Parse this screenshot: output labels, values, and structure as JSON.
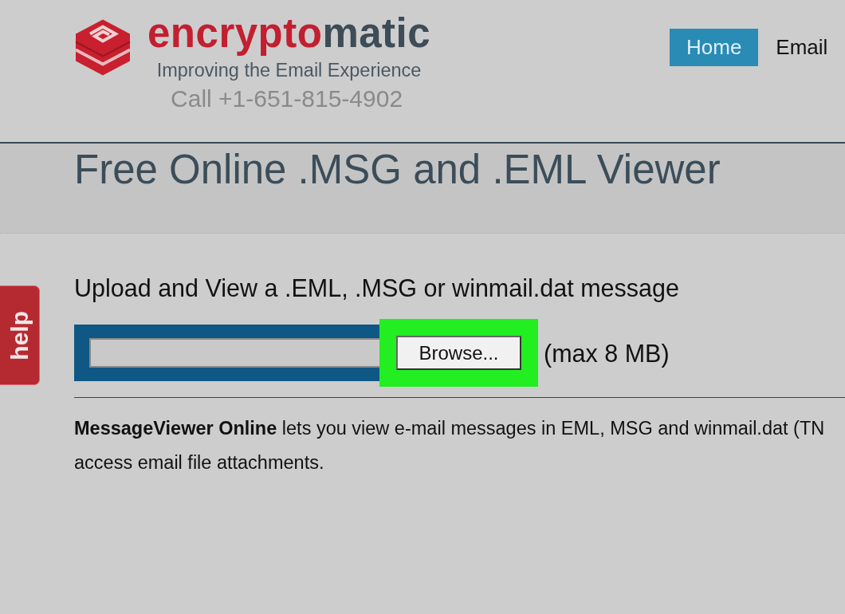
{
  "header": {
    "logo": {
      "wordmark": [
        {
          "text": "encrypto",
          "color": "#c21f30"
        },
        {
          "text": "matic",
          "color": "#3d4c57"
        }
      ],
      "tagline": "Improving the Email Experience",
      "phone": "Call +1-651-815-4902"
    },
    "nav": [
      {
        "label": "Home",
        "selected": true
      },
      {
        "label": "Email",
        "selected": false
      }
    ]
  },
  "title": "Free Online .MSG and .EML Viewer",
  "help_tab": {
    "label": "help"
  },
  "upload": {
    "heading": "Upload and View a .EML, .MSG or winmail.dat message",
    "browse_button": {
      "label": "Browse...",
      "highlighted": true
    },
    "size_limit": "(max 8 MB)"
  },
  "description": {
    "lines": [
      "**MessageViewer Online** lets you view e-mail messages in EML, MSG and winmail.dat (TN",
      "access email file attachments."
    ]
  }
}
